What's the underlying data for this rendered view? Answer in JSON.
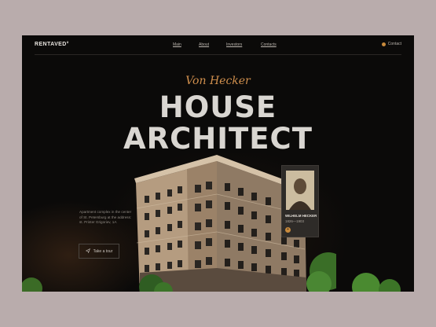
{
  "header": {
    "logo": "RENTAVED°",
    "nav": [
      {
        "label": "Main"
      },
      {
        "label": "About"
      },
      {
        "label": "Investors"
      },
      {
        "label": "Contacts"
      }
    ],
    "contact_label": "Contact"
  },
  "hero": {
    "tagline": "Von Hecker",
    "title_line1": "HOUSE",
    "title_line2": "ARCHITECT",
    "description": "Apartment complex in the center of St. Petersburg at the address: st. Printer Grigoriev, 1A",
    "cta_label": "Take a tour"
  },
  "architect_card": {
    "name": "WILHELM HECKER",
    "years": "1826—1903"
  },
  "colors": {
    "accent": "#d08f4d",
    "background": "#0b0a09",
    "outer": "#b9acac"
  }
}
